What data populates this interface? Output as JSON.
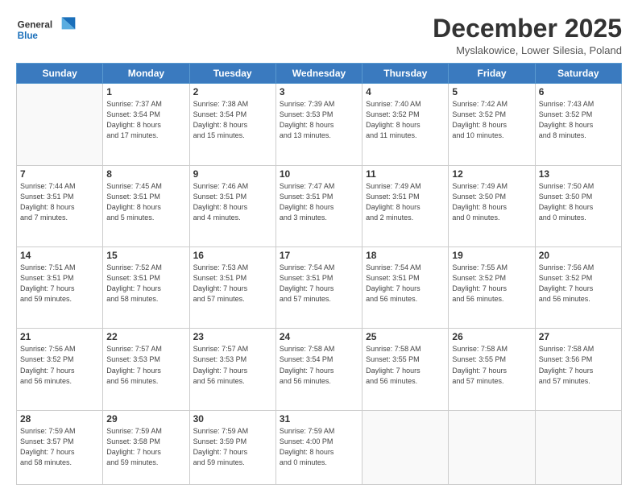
{
  "header": {
    "logo_general": "General",
    "logo_blue": "Blue",
    "month_title": "December 2025",
    "location": "Myslakowice, Lower Silesia, Poland"
  },
  "weekdays": [
    "Sunday",
    "Monday",
    "Tuesday",
    "Wednesday",
    "Thursday",
    "Friday",
    "Saturday"
  ],
  "weeks": [
    [
      {
        "day": "",
        "info": ""
      },
      {
        "day": "1",
        "info": "Sunrise: 7:37 AM\nSunset: 3:54 PM\nDaylight: 8 hours\nand 17 minutes."
      },
      {
        "day": "2",
        "info": "Sunrise: 7:38 AM\nSunset: 3:54 PM\nDaylight: 8 hours\nand 15 minutes."
      },
      {
        "day": "3",
        "info": "Sunrise: 7:39 AM\nSunset: 3:53 PM\nDaylight: 8 hours\nand 13 minutes."
      },
      {
        "day": "4",
        "info": "Sunrise: 7:40 AM\nSunset: 3:52 PM\nDaylight: 8 hours\nand 11 minutes."
      },
      {
        "day": "5",
        "info": "Sunrise: 7:42 AM\nSunset: 3:52 PM\nDaylight: 8 hours\nand 10 minutes."
      },
      {
        "day": "6",
        "info": "Sunrise: 7:43 AM\nSunset: 3:52 PM\nDaylight: 8 hours\nand 8 minutes."
      }
    ],
    [
      {
        "day": "7",
        "info": "Sunrise: 7:44 AM\nSunset: 3:51 PM\nDaylight: 8 hours\nand 7 minutes."
      },
      {
        "day": "8",
        "info": "Sunrise: 7:45 AM\nSunset: 3:51 PM\nDaylight: 8 hours\nand 5 minutes."
      },
      {
        "day": "9",
        "info": "Sunrise: 7:46 AM\nSunset: 3:51 PM\nDaylight: 8 hours\nand 4 minutes."
      },
      {
        "day": "10",
        "info": "Sunrise: 7:47 AM\nSunset: 3:51 PM\nDaylight: 8 hours\nand 3 minutes."
      },
      {
        "day": "11",
        "info": "Sunrise: 7:49 AM\nSunset: 3:51 PM\nDaylight: 8 hours\nand 2 minutes."
      },
      {
        "day": "12",
        "info": "Sunrise: 7:49 AM\nSunset: 3:50 PM\nDaylight: 8 hours\nand 0 minutes."
      },
      {
        "day": "13",
        "info": "Sunrise: 7:50 AM\nSunset: 3:50 PM\nDaylight: 8 hours\nand 0 minutes."
      }
    ],
    [
      {
        "day": "14",
        "info": "Sunrise: 7:51 AM\nSunset: 3:51 PM\nDaylight: 7 hours\nand 59 minutes."
      },
      {
        "day": "15",
        "info": "Sunrise: 7:52 AM\nSunset: 3:51 PM\nDaylight: 7 hours\nand 58 minutes."
      },
      {
        "day": "16",
        "info": "Sunrise: 7:53 AM\nSunset: 3:51 PM\nDaylight: 7 hours\nand 57 minutes."
      },
      {
        "day": "17",
        "info": "Sunrise: 7:54 AM\nSunset: 3:51 PM\nDaylight: 7 hours\nand 57 minutes."
      },
      {
        "day": "18",
        "info": "Sunrise: 7:54 AM\nSunset: 3:51 PM\nDaylight: 7 hours\nand 56 minutes."
      },
      {
        "day": "19",
        "info": "Sunrise: 7:55 AM\nSunset: 3:52 PM\nDaylight: 7 hours\nand 56 minutes."
      },
      {
        "day": "20",
        "info": "Sunrise: 7:56 AM\nSunset: 3:52 PM\nDaylight: 7 hours\nand 56 minutes."
      }
    ],
    [
      {
        "day": "21",
        "info": "Sunrise: 7:56 AM\nSunset: 3:52 PM\nDaylight: 7 hours\nand 56 minutes."
      },
      {
        "day": "22",
        "info": "Sunrise: 7:57 AM\nSunset: 3:53 PM\nDaylight: 7 hours\nand 56 minutes."
      },
      {
        "day": "23",
        "info": "Sunrise: 7:57 AM\nSunset: 3:53 PM\nDaylight: 7 hours\nand 56 minutes."
      },
      {
        "day": "24",
        "info": "Sunrise: 7:58 AM\nSunset: 3:54 PM\nDaylight: 7 hours\nand 56 minutes."
      },
      {
        "day": "25",
        "info": "Sunrise: 7:58 AM\nSunset: 3:55 PM\nDaylight: 7 hours\nand 56 minutes."
      },
      {
        "day": "26",
        "info": "Sunrise: 7:58 AM\nSunset: 3:55 PM\nDaylight: 7 hours\nand 57 minutes."
      },
      {
        "day": "27",
        "info": "Sunrise: 7:58 AM\nSunset: 3:56 PM\nDaylight: 7 hours\nand 57 minutes."
      }
    ],
    [
      {
        "day": "28",
        "info": "Sunrise: 7:59 AM\nSunset: 3:57 PM\nDaylight: 7 hours\nand 58 minutes."
      },
      {
        "day": "29",
        "info": "Sunrise: 7:59 AM\nSunset: 3:58 PM\nDaylight: 7 hours\nand 59 minutes."
      },
      {
        "day": "30",
        "info": "Sunrise: 7:59 AM\nSunset: 3:59 PM\nDaylight: 7 hours\nand 59 minutes."
      },
      {
        "day": "31",
        "info": "Sunrise: 7:59 AM\nSunset: 4:00 PM\nDaylight: 8 hours\nand 0 minutes."
      },
      {
        "day": "",
        "info": ""
      },
      {
        "day": "",
        "info": ""
      },
      {
        "day": "",
        "info": ""
      }
    ]
  ]
}
